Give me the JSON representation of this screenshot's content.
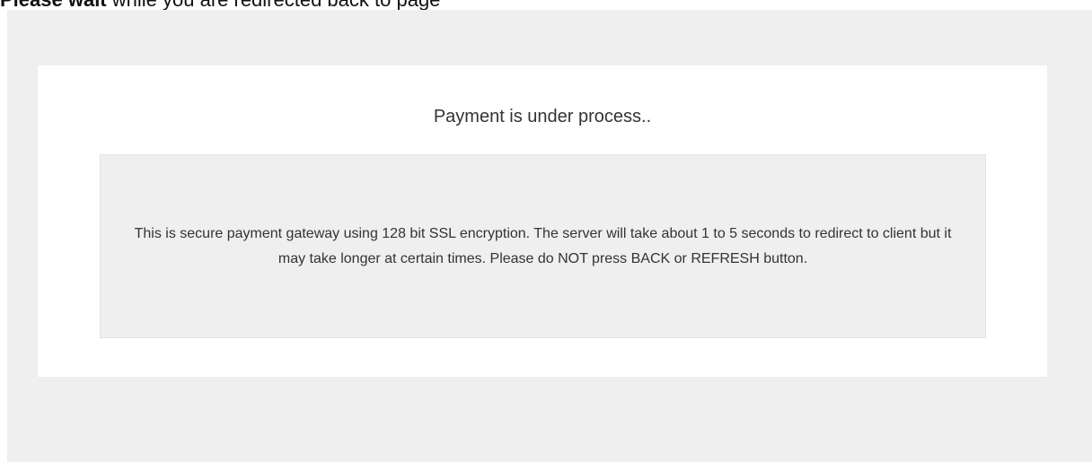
{
  "header": {
    "emphasis": "Please wait",
    "rest": " while you are redirected back to page"
  },
  "card": {
    "title": "Payment is under process..",
    "notice": "This is secure payment gateway using 128 bit SSL encryption. The server will take about 1 to 5 seconds to redirect to client but it may take longer at certain times. Please do NOT press BACK or REFRESH button."
  },
  "colors": {
    "panel_background": "#efefef",
    "card_background": "#ffffff",
    "text": "#333333"
  }
}
